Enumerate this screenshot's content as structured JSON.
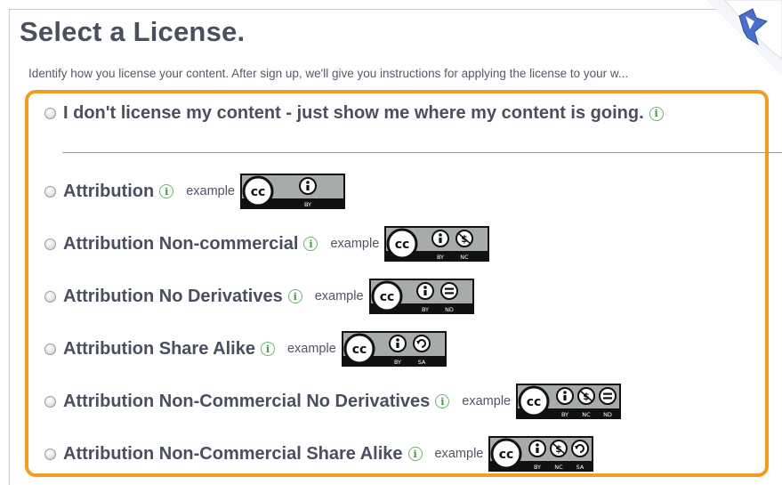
{
  "page": {
    "title": "Select a License.",
    "subtitle": "Identify how you license your content. After sign up, we'll give you instructions for applying the license to your w..."
  },
  "options": [
    {
      "label": "I don't license my content - just show me where my content is going.",
      "info_icon": "info-icon",
      "example": "",
      "badge": []
    },
    {
      "label": "Attribution",
      "info_icon": "info-icon",
      "example": "example",
      "badge": [
        "BY"
      ]
    },
    {
      "label": "Attribution Non-commercial",
      "info_icon": "info-icon",
      "example": "example",
      "badge": [
        "BY",
        "NC"
      ]
    },
    {
      "label": "Attribution No Derivatives",
      "info_icon": "info-icon",
      "example": "example",
      "badge": [
        "BY",
        "ND"
      ]
    },
    {
      "label": "Attribution Share Alike",
      "info_icon": "info-icon",
      "example": "example",
      "badge": [
        "BY",
        "SA"
      ]
    },
    {
      "label": "Attribution Non-Commercial No Derivatives",
      "info_icon": "info-icon",
      "example": "example",
      "badge": [
        "BY",
        "NC",
        "ND"
      ]
    },
    {
      "label": "Attribution Non-Commercial Share Alike",
      "info_icon": "info-icon",
      "example": "example",
      "badge": [
        "BY",
        "NC",
        "SA"
      ]
    }
  ],
  "badge_logo": "cc",
  "colors": {
    "accent": "#f39c21",
    "text": "#4a4f60",
    "info": "#3f9a45",
    "badge_bg": "#a8aca9",
    "badge_dark": "#111111"
  }
}
